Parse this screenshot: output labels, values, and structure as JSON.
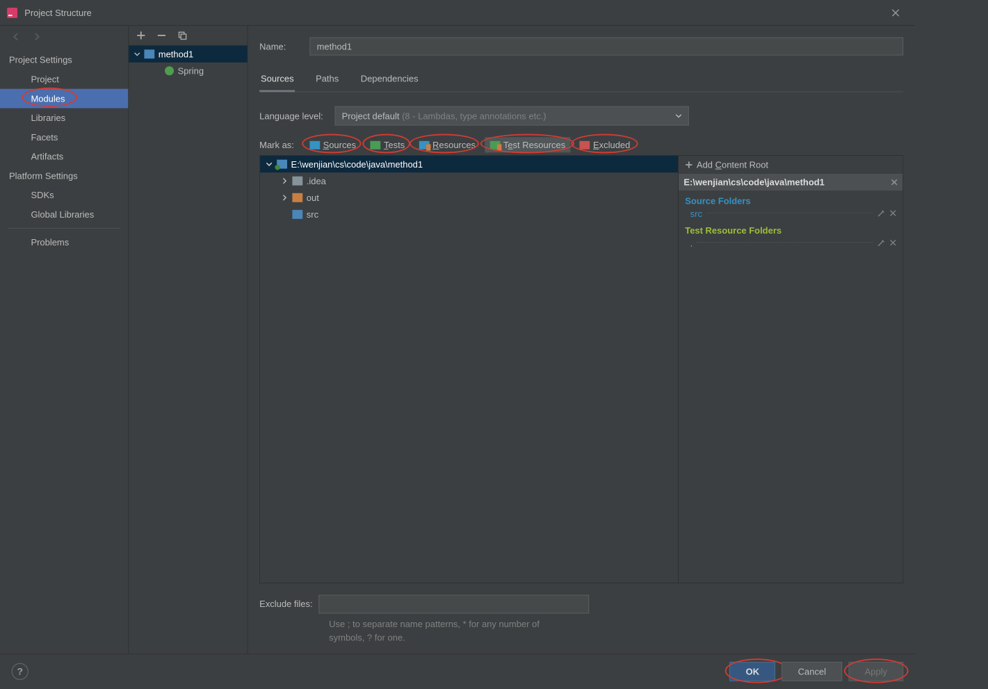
{
  "window": {
    "title": "Project Structure"
  },
  "sidebar": {
    "sections": [
      {
        "title": "Project Settings",
        "items": [
          "Project",
          "Modules",
          "Libraries",
          "Facets",
          "Artifacts"
        ],
        "selected_index": 1
      },
      {
        "title": "Platform Settings",
        "items": [
          "SDKs",
          "Global Libraries"
        ]
      }
    ],
    "problems": "Problems"
  },
  "module_tree": {
    "root": "method1",
    "children": [
      "Spring"
    ]
  },
  "main": {
    "name_label": "Name:",
    "name_value": "method1",
    "tabs": [
      "Sources",
      "Paths",
      "Dependencies"
    ],
    "active_tab": 0,
    "lang_label": "Language level:",
    "lang_value": "Project default",
    "lang_hint": "(8 - Lambdas, type annotations etc.)",
    "markas_label": "Mark as:",
    "markas": {
      "sources": "Sources",
      "tests": "Tests",
      "resources": "Resources",
      "testres": "Test Resources",
      "excluded": "Excluded"
    },
    "file_tree": {
      "root": "E:\\wenjian\\cs\\code\\java\\method1",
      "children": [
        {
          "name": ".idea",
          "type": "folder",
          "expandable": true
        },
        {
          "name": "out",
          "type": "folder-orange",
          "expandable": true
        },
        {
          "name": "src",
          "type": "folder-blue",
          "expandable": false
        }
      ]
    },
    "right": {
      "add_root": "Add Content Root",
      "root_path": "E:\\wenjian\\cs\\code\\java\\method1",
      "source_folders_head": "Source Folders",
      "source_folders": [
        "src"
      ],
      "test_res_head": "Test Resource Folders",
      "test_res_folders": [
        "."
      ]
    },
    "exclude_label": "Exclude files:",
    "exclude_hint_l1": "Use ; to separate name patterns, * for any number of",
    "exclude_hint_l2": "symbols, ? for one."
  },
  "buttons": {
    "ok": "OK",
    "cancel": "Cancel",
    "apply": "Apply"
  }
}
